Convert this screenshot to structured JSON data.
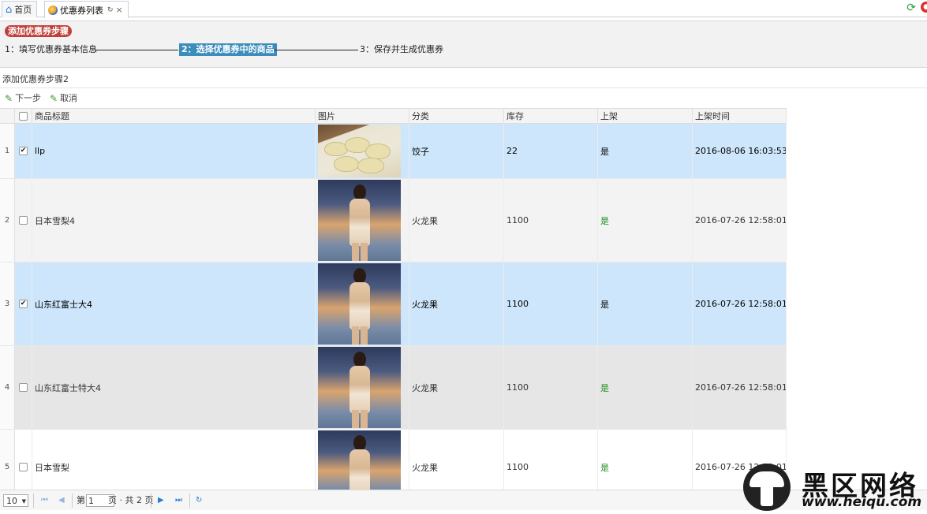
{
  "tabs": [
    {
      "label": "首页",
      "icon": "home-icon"
    },
    {
      "label": "优惠券列表",
      "icon": "coupon-list-icon",
      "close": "×",
      "refresh": "↻"
    }
  ],
  "steps_panel": {
    "badge": "添加优惠券步骤",
    "steps": [
      {
        "label": "1：填写优惠券基本信息",
        "current": false
      },
      {
        "label": "2：选择优惠券中的商品",
        "current": true
      },
      {
        "label": "3：保存并生成优惠券",
        "current": false
      }
    ]
  },
  "section_title": "添加优惠券步骤2",
  "toolbar": {
    "next_label": "下一步",
    "cancel_label": "取消"
  },
  "grid": {
    "columns": [
      "商品标题",
      "图片",
      "分类",
      "库存",
      "上架",
      "上架时间"
    ],
    "rows": [
      {
        "num": "1",
        "checked": true,
        "title": "llp",
        "image": "dumpling",
        "category": "饺子",
        "stock": "22",
        "on_shelf": "是",
        "time": "2016-08-06 16:03:53"
      },
      {
        "num": "2",
        "checked": false,
        "title": "日本雪梨4",
        "image": "model-photo",
        "category": "火龙果",
        "stock": "1100",
        "on_shelf": "是",
        "time": "2016-07-26 12:58:01"
      },
      {
        "num": "3",
        "checked": true,
        "title": "山东红富士大4",
        "image": "model-photo",
        "category": "火龙果",
        "stock": "1100",
        "on_shelf": "是",
        "time": "2016-07-26 12:58:01"
      },
      {
        "num": "4",
        "checked": false,
        "title": "山东红富士特大4",
        "image": "model-photo",
        "category": "火龙果",
        "stock": "1100",
        "on_shelf": "是",
        "time": "2016-07-26 12:58:01"
      },
      {
        "num": "5",
        "checked": false,
        "title": "日本雪梨",
        "image": "model-photo",
        "category": "火龙果",
        "stock": "1100",
        "on_shelf": "是",
        "time": "2016-07-26 12:58:01"
      }
    ]
  },
  "pager": {
    "page_size": "10",
    "page_label": "第",
    "page_value": "1",
    "page_total": "页 · 共 2 页"
  },
  "watermark": {
    "text": "黑区网络",
    "url": "www.heiqu.com"
  },
  "colors": {
    "selected_row": "#cde6fb",
    "badge": "#c0403a",
    "current_step": "#3c8dbc",
    "yes_green": "#1d8d1d"
  }
}
